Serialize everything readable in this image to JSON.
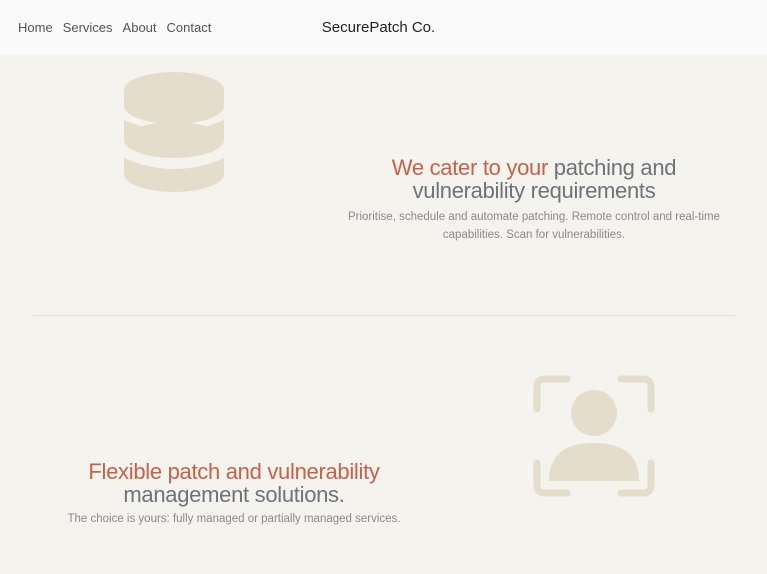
{
  "header": {
    "nav": {
      "home": "Home",
      "services": "Services",
      "about": "About",
      "contact": "Contact"
    },
    "brand": "SecurePatch Co."
  },
  "section1": {
    "icon": "database-icon",
    "headline_accent": "We cater to your",
    "headline_rest_1": " patching and",
    "headline_rest_2": "vulnerability requirements",
    "subtext_1": "Prioritise, schedule and automate patching. Remote control and real-time",
    "subtext_2": "capabilities. Scan for vulnerabilities."
  },
  "section2": {
    "icon": "user-scan-icon",
    "headline_accent": "Flexible patch and vulnerability",
    "headline_rest": "management solutions.",
    "subtext": "The choice is yours: fully managed or partially managed services."
  },
  "colors": {
    "accent": "#c8614a",
    "muted_heading": "#6e727a",
    "icon_tint": "#e5ddcc",
    "background": "#f5f3ee",
    "header_bg": "#fafafa"
  }
}
